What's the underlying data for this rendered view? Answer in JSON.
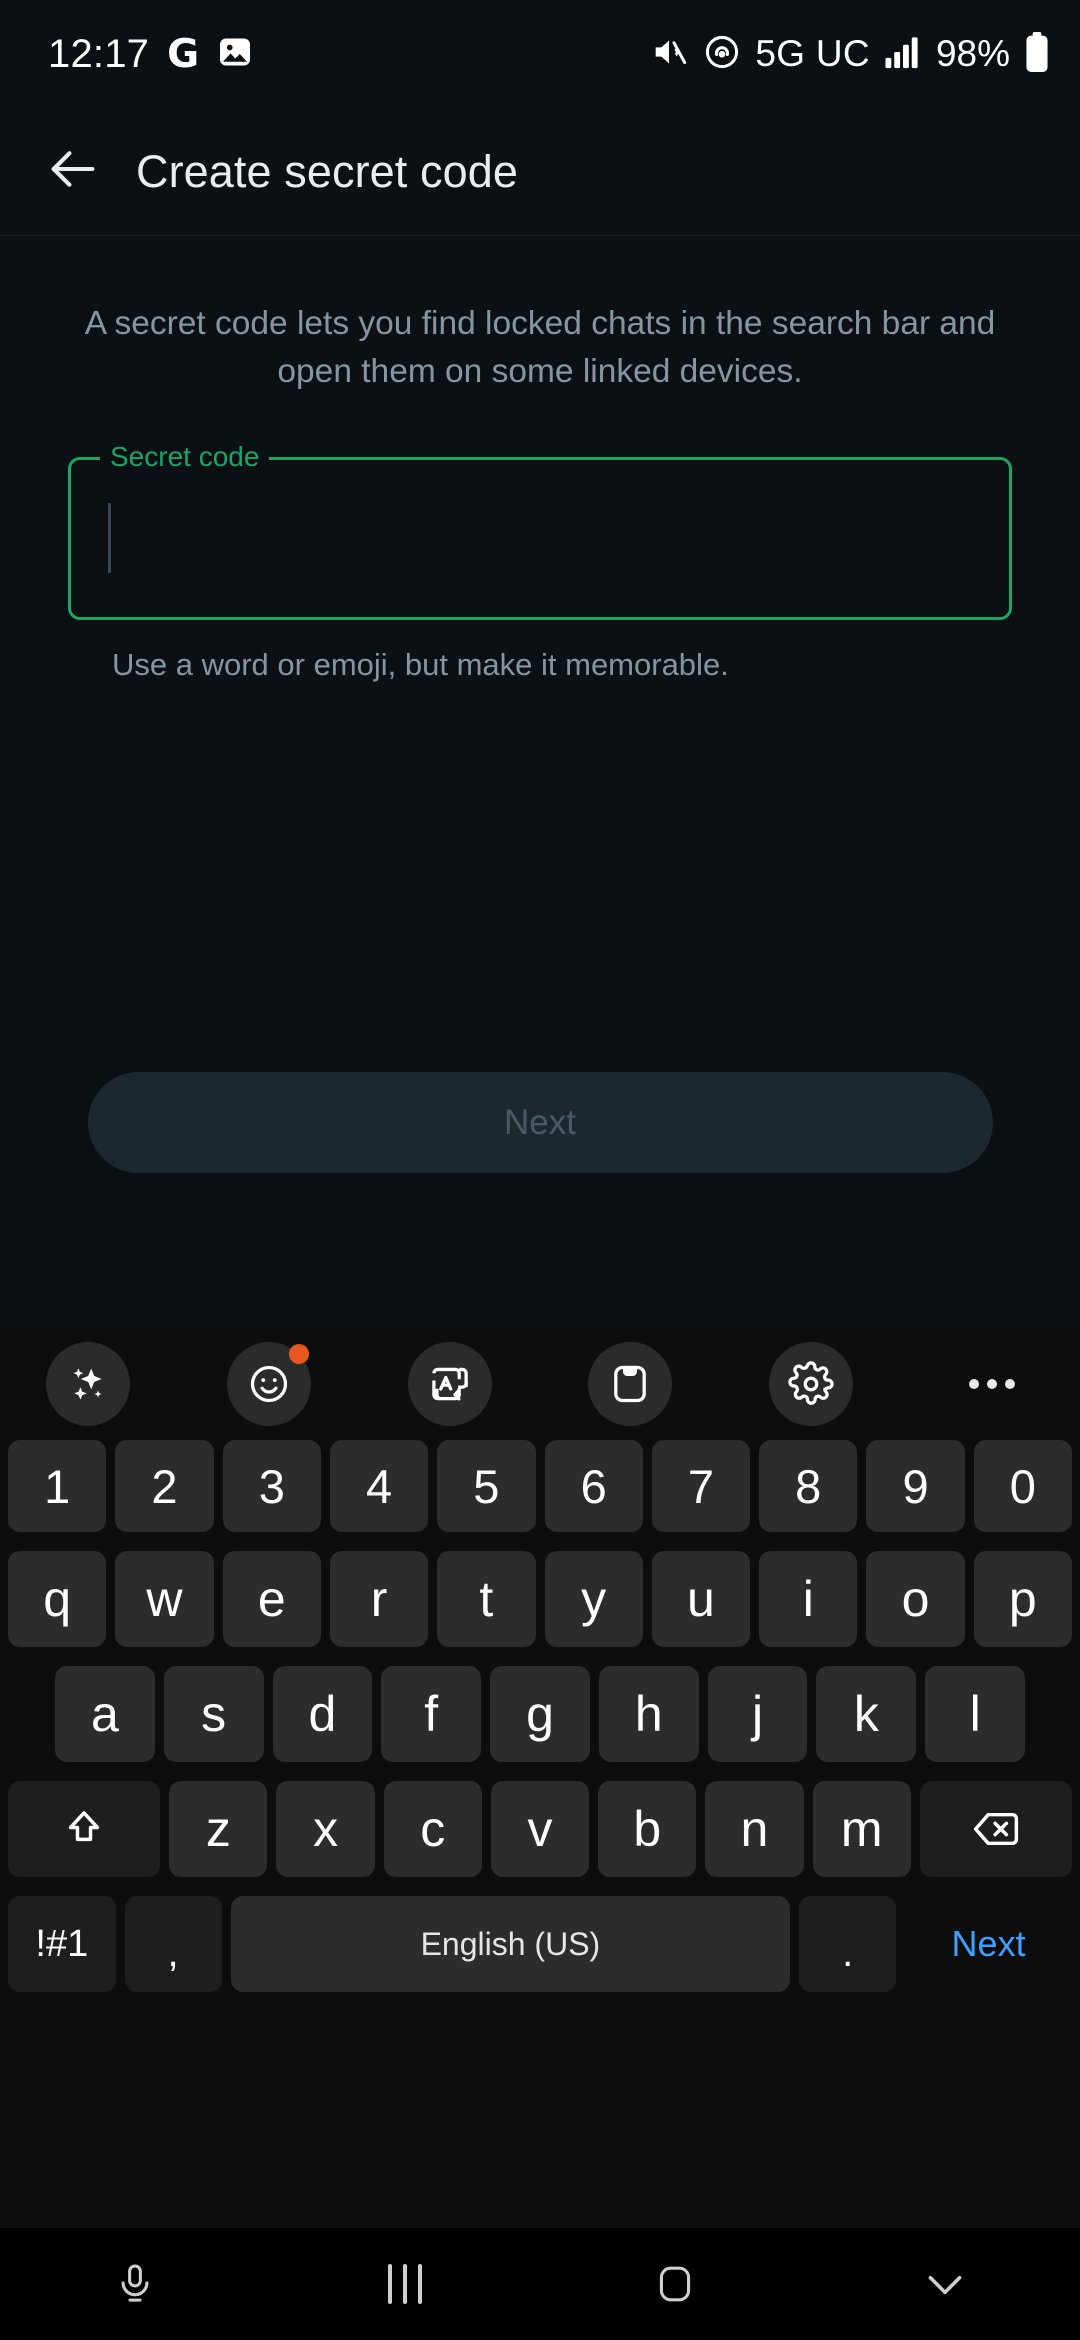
{
  "status_bar": {
    "time": "12:17",
    "left_icons": [
      "google-g-icon",
      "photos-icon"
    ],
    "g_label": "G",
    "right_icons": [
      "mute-icon",
      "hotspot-icon",
      "signal-icon",
      "battery-icon"
    ],
    "network": "5G UC",
    "battery": "98%"
  },
  "app_bar": {
    "back_icon": "back-arrow-icon",
    "title": "Create secret code"
  },
  "main": {
    "description": "A secret code lets you find locked chats in the search bar and open them on some linked devices.",
    "field": {
      "label": "Secret code",
      "value": "",
      "placeholder": ""
    },
    "helper_text": "Use a word or emoji, but make it memorable.",
    "next_button": "Next"
  },
  "colors": {
    "accent_green": "#1da566",
    "background": "#0b1014",
    "keyboard_bg": "#0d0d0d",
    "badge_orange": "#e8561f",
    "next_key_blue": "#3ea0ff"
  },
  "keyboard": {
    "toolbar": [
      {
        "name": "ai-sparkle-icon",
        "badge": false
      },
      {
        "name": "emoji-icon",
        "badge": true
      },
      {
        "name": "translate-icon",
        "badge": false
      },
      {
        "name": "clipboard-icon",
        "badge": false
      },
      {
        "name": "settings-gear-icon",
        "badge": false
      },
      {
        "name": "more-options-icon",
        "badge": false
      }
    ],
    "row_numbers": [
      "1",
      "2",
      "3",
      "4",
      "5",
      "6",
      "7",
      "8",
      "9",
      "0"
    ],
    "row_top": [
      "q",
      "w",
      "e",
      "r",
      "t",
      "y",
      "u",
      "i",
      "o",
      "p"
    ],
    "row_home": [
      "a",
      "s",
      "d",
      "f",
      "g",
      "h",
      "j",
      "k",
      "l"
    ],
    "row_bottom": [
      "z",
      "x",
      "c",
      "v",
      "b",
      "n",
      "m"
    ],
    "shift_icon": "shift-icon",
    "backspace_icon": "backspace-icon",
    "symbols_key": "!#1",
    "comma_key": ",",
    "space_key": "English (US)",
    "period_key": ".",
    "enter_key": "Next"
  },
  "nav_bar": {
    "mic_icon": "microphone-icon",
    "recents_icon": "recents-icon",
    "home_icon": "home-icon",
    "hide_keyboard_icon": "chevron-down-icon"
  }
}
